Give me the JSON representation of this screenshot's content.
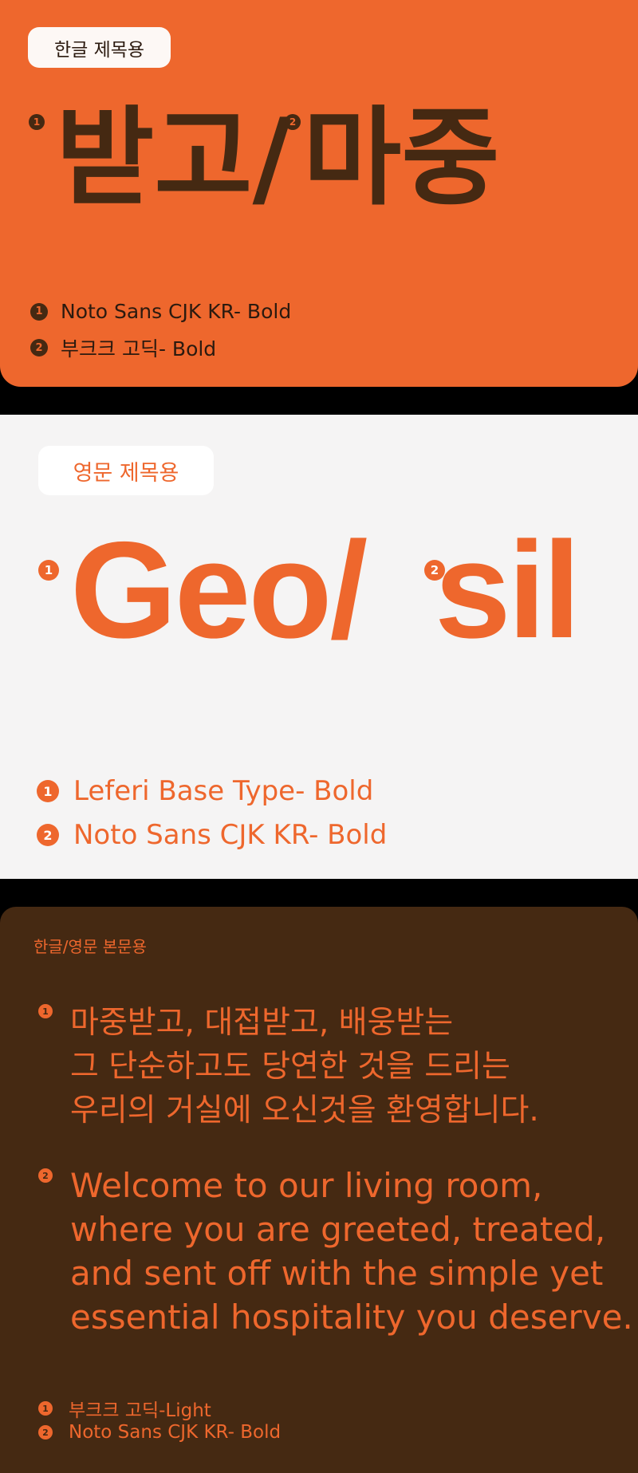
{
  "korean_title": {
    "tag": "한글 제목용",
    "hero_part1": "받고/",
    "hero_part2": "마중",
    "marker1": "1",
    "marker2": "2",
    "fonts": [
      {
        "index": "1",
        "label": "Noto Sans CJK KR- Bold"
      },
      {
        "index": "2",
        "label": "부크크 고딕- Bold"
      }
    ]
  },
  "english_title": {
    "tag": "영문 제목용",
    "hero_part1": "Geo/",
    "hero_part2": "sil",
    "marker1": "1",
    "marker2": "2",
    "fonts": [
      {
        "index": "1",
        "label": "Leferi Base Type- Bold"
      },
      {
        "index": "2",
        "label": "Noto Sans CJK KR- Bold"
      }
    ]
  },
  "body_text": {
    "tag": "한글/영문 본문용",
    "marker1": "1",
    "marker2": "2",
    "korean_lines": [
      "마중받고, 대접받고, 배웅받는",
      "그 단순하고도 당연한 것을 드리는",
      "우리의 거실에 오신것을 환영합니다."
    ],
    "english_lines": [
      "Welcome to our living room,",
      "where you are greeted, treated,",
      "and sent off with the simple yet",
      "essential hospitality you deserve."
    ],
    "fonts": [
      {
        "index": "1",
        "label": "부크크 고딕-Light"
      },
      {
        "index": "2",
        "label": "Noto Sans CJK KR- Bold"
      }
    ]
  },
  "colors": {
    "orange": "#ee672d",
    "brown": "#452912",
    "light_gray": "#f5f4f4"
  }
}
